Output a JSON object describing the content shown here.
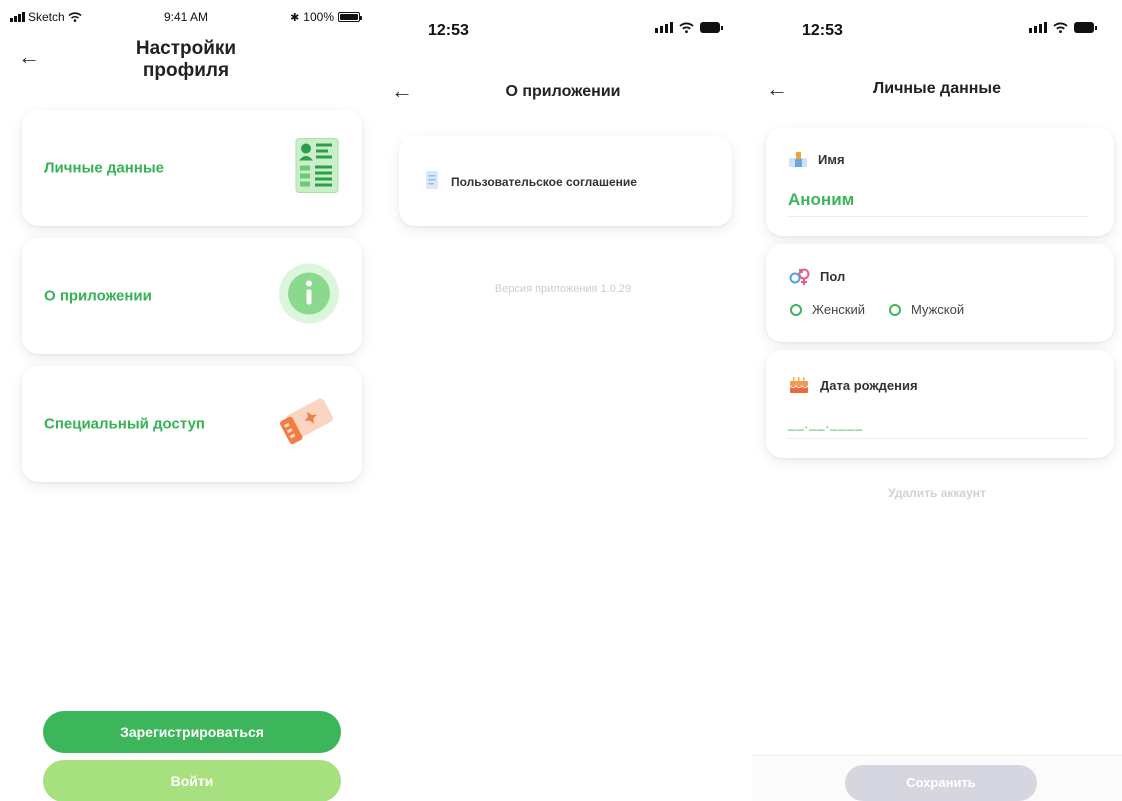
{
  "screen1": {
    "status": {
      "carrier": "Sketch",
      "time": "9:41 AM",
      "battery": "100%"
    },
    "title_line1": "Настройки",
    "title_line2": "профиля",
    "cards": [
      {
        "label": "Личные данные",
        "icon": "contact-card-icon"
      },
      {
        "label": "О приложении",
        "icon": "info-icon"
      },
      {
        "label": "Специальный доступ",
        "icon": "ticket-icon"
      }
    ],
    "register_label": "Зарегистрироваться",
    "login_label": "Войти"
  },
  "screen2": {
    "time": "12:53",
    "title": "О приложении",
    "agreement_label": "Пользовательское соглашение",
    "version_text": "Версия приложения 1.0.29"
  },
  "screen3": {
    "time": "12:53",
    "title": "Личные данные",
    "name_label": "Имя",
    "name_value": "Аноним",
    "gender_label": "Пол",
    "gender_options": [
      "Женский",
      "Мужской"
    ],
    "birth_label": "Дата рождения",
    "birth_placeholder": "__.__.____",
    "delete_label": "Удалить аккаунт",
    "save_label": "Сохранить"
  },
  "colors": {
    "accent_green": "#3cb55b",
    "light_green": "#a7e07e",
    "disabled": "#d6d6e0"
  }
}
